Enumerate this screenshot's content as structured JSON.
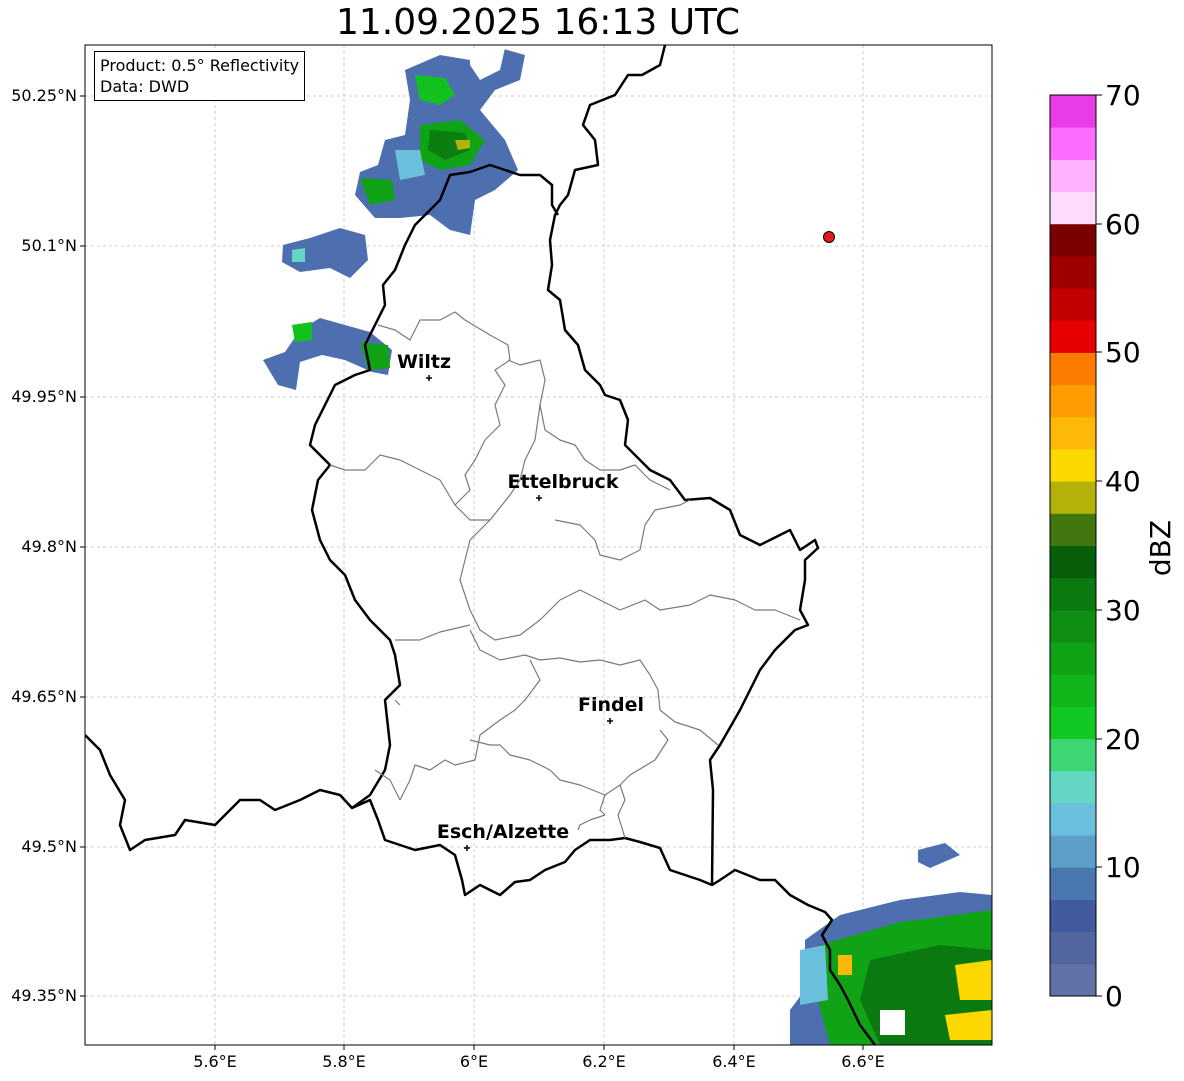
{
  "title": "11.09.2025 16:13 UTC",
  "info": {
    "product": "Product: 0.5° Reflectivity",
    "data": "Data: DWD"
  },
  "axes": {
    "lon_ticks": [
      "5.6°E",
      "5.8°E",
      "6°E",
      "6.2°E",
      "6.4°E",
      "6.6°E"
    ],
    "lat_ticks": [
      "50.25°N",
      "50.1°N",
      "49.95°N",
      "49.8°N",
      "49.65°N",
      "49.5°N",
      "49.35°N"
    ],
    "lon_range": [
      5.4,
      6.8
    ],
    "lat_range": [
      49.3,
      50.3
    ]
  },
  "cities": [
    {
      "name": "Wiltz",
      "lon": 5.93,
      "lat": 49.97
    },
    {
      "name": "Ettelbruck",
      "lon": 6.1,
      "lat": 49.85
    },
    {
      "name": "Findel",
      "lon": 6.21,
      "lat": 49.63
    },
    {
      "name": "Esch/Alzette",
      "lon": 5.99,
      "lat": 49.5
    }
  ],
  "marker": {
    "lon": 6.55,
    "lat": 50.11,
    "color": "#e31a1c"
  },
  "colorbar": {
    "label": "dBZ",
    "ticks": [
      "0",
      "10",
      "20",
      "30",
      "40",
      "50",
      "60",
      "70"
    ],
    "colors": [
      "#6272a8",
      "#52659f",
      "#425aa0",
      "#4a77b0",
      "#5b9ec8",
      "#6ac0dc",
      "#64d6c4",
      "#3ed672",
      "#12c823",
      "#10b61a",
      "#10a316",
      "#0e8e13",
      "#0a7a10",
      "#075e0b",
      "#42760f",
      "#b2b208",
      "#fdd800",
      "#fdb808",
      "#fd9d02",
      "#fd7c00",
      "#e60000",
      "#c10000",
      "#9e0000",
      "#7b0000",
      "#ffdcfd",
      "#ffb2fd",
      "#fd6dfd",
      "#e83ce9"
    ]
  }
}
